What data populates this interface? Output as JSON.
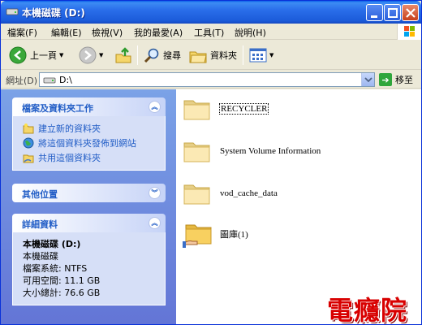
{
  "window": {
    "title": "本機磁碟 (D:)"
  },
  "menu": [
    "檔案(F)",
    "編輯(E)",
    "檢視(V)",
    "我的最愛(A)",
    "工具(T)",
    "說明(H)"
  ],
  "toolbar": {
    "back_label": "上一頁",
    "search_label": "搜尋",
    "folders_label": "資料夾"
  },
  "address": {
    "label": "網址(D)",
    "value": "D:\\",
    "go_label": "移至"
  },
  "taskpane": {
    "file_tasks": {
      "title": "檔案及資料夾工作",
      "items": [
        "建立新的資料夾",
        "將這個資料夾發佈到網站",
        "共用這個資料夾"
      ]
    },
    "other_places": {
      "title": "其他位置"
    },
    "details": {
      "title": "詳細資料",
      "name": "本機磁碟 (D:)",
      "type": "本機磁碟",
      "filesystem": "檔案系統: NTFS",
      "free": "可用空間: 11.1 GB",
      "total": "大小總計: 76.6 GB"
    }
  },
  "files": [
    {
      "name": "RECYCLER"
    },
    {
      "name": "System Volume Information"
    },
    {
      "name": "vod_cache_data"
    },
    {
      "name": "圖庫(1)"
    }
  ],
  "watermark": "電癮院",
  "colors": {
    "title_bar": "#2A6EEA",
    "link": "#215DC6",
    "task_pane": "#7BA2E7",
    "watermark": "#D80000"
  }
}
